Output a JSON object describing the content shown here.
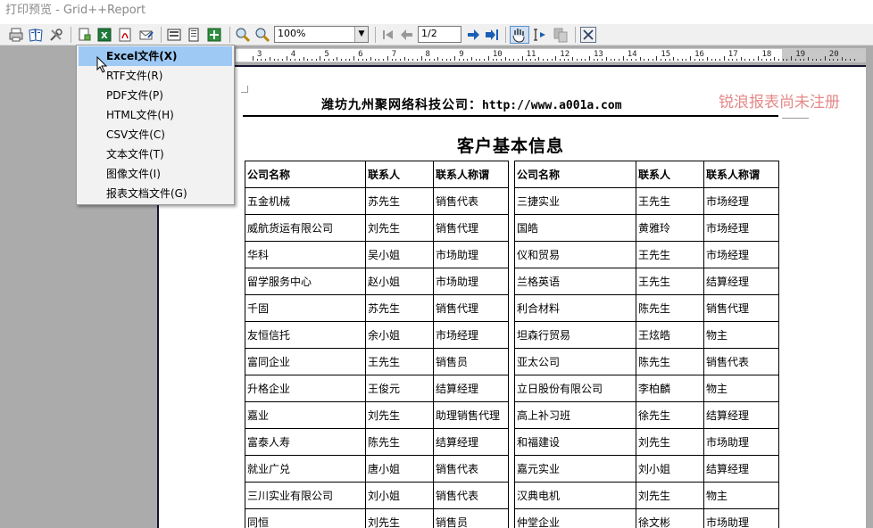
{
  "window": {
    "title": "打印预览 - Grid++Report"
  },
  "toolbar": {
    "zoom_value": "100%",
    "page_value": "1/2",
    "icons": [
      "print-icon",
      "page-setup-icon",
      "settings-icon",
      "export-icon",
      "excel-export-icon",
      "pdf-export-icon",
      "email-icon",
      "single-page-icon",
      "two-page-icon",
      "multi-page-icon",
      "zoom-in-icon",
      "zoom-out-icon",
      "first-page-icon",
      "prev-page-icon",
      "next-page-icon",
      "last-page-icon",
      "hand-tool-icon",
      "select-tool-icon",
      "copy-icon",
      "close-icon"
    ]
  },
  "ruler": {
    "labels": [
      "3",
      "4",
      "5",
      "6",
      "7",
      "8",
      "9",
      "10",
      "11",
      "12",
      "13",
      "14",
      "15",
      "16",
      "17",
      "18",
      "19",
      "20"
    ]
  },
  "export_menu": {
    "items": [
      {
        "label": "Excel文件(X)",
        "selected": true
      },
      {
        "label": "RTF文件(R)"
      },
      {
        "label": "PDF文件(P)"
      },
      {
        "label": "HTML文件(H)"
      },
      {
        "label": "CSV文件(C)"
      },
      {
        "label": "文本文件(T)"
      },
      {
        "label": "图像文件(I)"
      },
      {
        "label": "报表文档文件(G)"
      }
    ]
  },
  "report": {
    "company": "潍坊九州聚网络科技公司：",
    "url": "http://www.a001a.com",
    "watermark": "锐浪报表尚未注册",
    "title": "客户基本信息",
    "columns": [
      "公司名称",
      "联系人",
      "联系人称谓"
    ],
    "left_rows": [
      [
        "五金机械",
        "苏先生",
        "销售代表"
      ],
      [
        "威航货运有限公司",
        "刘先生",
        "销售代理"
      ],
      [
        "华科",
        "吴小姐",
        "市场助理"
      ],
      [
        "留学服务中心",
        "赵小姐",
        "市场助理"
      ],
      [
        "千固",
        "苏先生",
        "销售代理"
      ],
      [
        "友恒信托",
        "余小姐",
        "市场经理"
      ],
      [
        "富同企业",
        "王先生",
        "销售员"
      ],
      [
        "升格企业",
        "王俊元",
        "结算经理"
      ],
      [
        "嘉业",
        "刘先生",
        "助理销售代理"
      ],
      [
        "富泰人寿",
        "陈先生",
        "结算经理"
      ],
      [
        "就业广兑",
        "唐小姐",
        "销售代表"
      ],
      [
        "三川实业有限公司",
        "刘小姐",
        "销售代表"
      ],
      [
        "同恒",
        "刘先生",
        "销售员"
      ]
    ],
    "right_rows": [
      [
        "三捷实业",
        "王先生",
        "市场经理"
      ],
      [
        "国皓",
        "黄雅玲",
        "市场经理"
      ],
      [
        "仪和贸易",
        "王先生",
        "市场经理"
      ],
      [
        "兰格英语",
        "王先生",
        "结算经理"
      ],
      [
        "利合材料",
        "陈先生",
        "销售代理"
      ],
      [
        "坦森行贸易",
        "王炫皓",
        "物主"
      ],
      [
        "亚太公司",
        "陈先生",
        "销售代表"
      ],
      [
        "立日股份有限公司",
        "李柏麟",
        "物主"
      ],
      [
        "高上补习班",
        "徐先生",
        "结算经理"
      ],
      [
        "和福建设",
        "刘先生",
        "市场助理"
      ],
      [
        "嘉元实业",
        "刘小姐",
        "结算经理"
      ],
      [
        "汉典电机",
        "刘先生",
        "物主"
      ],
      [
        "仲堂企业",
        "徐文彬",
        "市场助理"
      ]
    ]
  }
}
